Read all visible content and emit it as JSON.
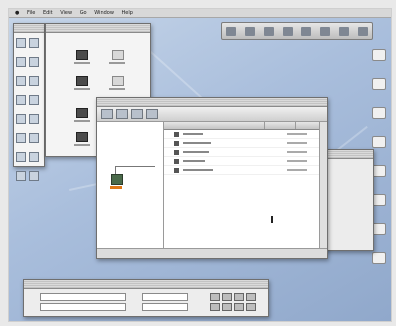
{
  "screen": {
    "menubar": {
      "items": [
        "",
        "File",
        "Edit",
        "View",
        "Go",
        "Window",
        "Help"
      ],
      "clock": ""
    },
    "windows": {
      "main_browser": {
        "rows": [
          {
            "name": "",
            "size": ""
          },
          {
            "name": "",
            "size": ""
          },
          {
            "name": "",
            "size": ""
          },
          {
            "name": "",
            "size": ""
          },
          {
            "name": "",
            "size": ""
          }
        ]
      }
    },
    "colors": {
      "desktop": "#a9bedc",
      "selection": "#e07818",
      "window_bg": "#f4f4f4"
    },
    "icons": {
      "menu_left": "apple-logo-icon",
      "desktop": [
        "hard-drive-icon",
        "folder-icon",
        "folder-icon",
        "network-icon",
        "trash-icon"
      ]
    }
  }
}
